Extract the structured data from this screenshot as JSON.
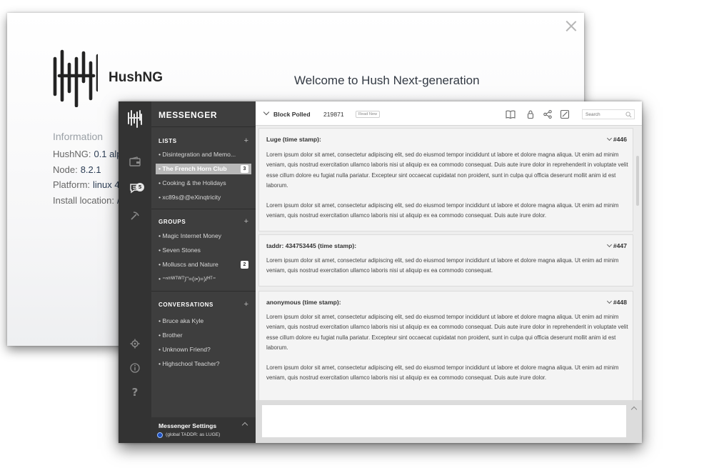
{
  "back_window": {
    "brand": "HushNG",
    "welcome": "Welcome to Hush Next-generation",
    "info_title": "Information",
    "info": [
      {
        "label": "HushNG:",
        "value": "0.1 alph"
      },
      {
        "label": "Node:",
        "value": "8.2.1"
      },
      {
        "label": "Platform:",
        "value": "linux 4"
      },
      {
        "label": "Install location:",
        "value": "/"
      }
    ]
  },
  "rail": {
    "icons": [
      "hush-logo-icon",
      "wallet-icon",
      "messenger-icon",
      "mining-icon",
      "settings-icon",
      "info-icon",
      "help-icon"
    ],
    "messenger_badge": "5",
    "help_glyph": "?"
  },
  "sidebar": {
    "title": "MESSENGER",
    "lists_header": "LISTS",
    "lists": [
      {
        "label": "• Disintegration and Memo...",
        "count": ""
      },
      {
        "label": "• The French Horn Club",
        "count": "3"
      },
      {
        "label": "• Cooking & the Holidays",
        "count": ""
      },
      {
        "label": "• xc89s@@eXinqtricity",
        "count": ""
      }
    ],
    "groups_header": "GROUPS",
    "groups": [
      {
        "label": "• Magic Internet Money",
        "count": ""
      },
      {
        "label": "• Seven Stones",
        "count": ""
      },
      {
        "label": "• Molluscs and Nature",
        "count": "2"
      },
      {
        "label": "• ⁼ⁿᵐᵂᵀᵂᵀ)ʺ=(ı•)=)/ᴴᵀ⁼",
        "count": ""
      }
    ],
    "conversations_header": "CONVERSATIONS",
    "conversations": [
      {
        "label": "• Bruce aka Kyle"
      },
      {
        "label": "• Brother"
      },
      {
        "label": "• Unknown Friend?"
      },
      {
        "label": "• Highschool Teacher?"
      }
    ],
    "plus_glyph": "+",
    "footer": {
      "title": "Messenger Settings",
      "subtitle": "(global TADDR: as LUGE)"
    }
  },
  "topbar": {
    "label": "Block Polled",
    "block_number": "219871",
    "read_new": "Read New",
    "icons": [
      "book-icon",
      "lock-icon",
      "share-icon",
      "edit-icon"
    ],
    "search_placeholder": "Search"
  },
  "messages": [
    {
      "head": "Luge (time stamp):",
      "num": "#446",
      "paragraphs": [
        "Lorem ipsum dolor sit amet, consectetur adipiscing elit, sed do eiusmod tempor incididunt ut labore et dolore magna aliqua. Ut enim ad minim veniam, quis nostrud exercitation ullamco laboris nisi ut aliquip ex ea commodo consequat. Duis aute irure dolor in reprehenderit in voluptate velit esse cillum dolore eu fugiat nulla pariatur. Excepteur sint occaecat cupidatat non proident, sunt in culpa qui officia deserunt mollit anim id est laborum.",
        "Lorem ipsum dolor sit amet, consectetur adipiscing elit, sed do eiusmod tempor incididunt ut labore et dolore magna aliqua. Ut enim ad minim veniam, quis nostrud exercitation ullamco laboris nisi ut aliquip ex ea commodo consequat. Duis aute irure dolor."
      ]
    },
    {
      "head": "taddr: 434753445 (time stamp):",
      "num": "#447",
      "paragraphs": [
        "Lorem ipsum dolor sit amet, consectetur adipiscing elit, sed do eiusmod tempor incididunt ut labore et dolore magna aliqua. Ut enim ad minim veniam, quis nostrud exercitation ullamco laboris nisi ut aliquip ex ea commodo consequat."
      ]
    },
    {
      "head": "anonymous (time stamp):",
      "num": "#448",
      "paragraphs": [
        "Lorem ipsum dolor sit amet, consectetur adipiscing elit, sed do eiusmod tempor incididunt ut labore et dolore magna aliqua. Ut enim ad minim veniam, quis nostrud exercitation ullamco laboris nisi ut aliquip ex ea commodo consequat. Duis aute irure dolor in reprehenderit in voluptate velit esse cillum dolore eu fugiat nulla pariatur. Excepteur sint occaecat cupidatat non proident, sunt in culpa qui officia deserunt mollit anim id est laborum.",
        "Lorem ipsum dolor sit amet, consectetur adipiscing elit, sed do eiusmod tempor incididunt ut labore et dolore magna aliqua. Ut enim ad minim veniam, quis nostrud exercitation ullamco laboris nisi ut aliquip ex ea commodo consequat. Duis aute irure dolor."
      ]
    }
  ],
  "composer": {
    "placeholder": ""
  }
}
